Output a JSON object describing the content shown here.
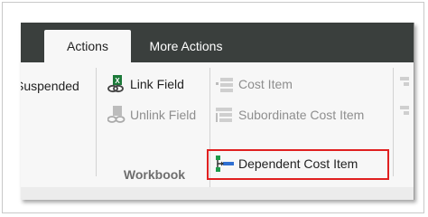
{
  "tabs": [
    {
      "label": "Actions",
      "active": true
    },
    {
      "label": "More Actions",
      "active": false
    }
  ],
  "partial_item": {
    "label": "Suspended"
  },
  "workbook_group": {
    "label": "Workbook",
    "link_field": {
      "label": "Link Field",
      "enabled": true
    },
    "unlink_field": {
      "label": "Unlink Field",
      "enabled": false
    }
  },
  "cost_group": {
    "cost_item": {
      "label": "Cost Item",
      "enabled": false
    },
    "subordinate_cost_item": {
      "label": "Subordinate Cost Item",
      "enabled": false
    },
    "dependent_cost_item": {
      "label": "Dependent Cost Item",
      "enabled": true,
      "highlighted": true
    }
  },
  "colors": {
    "tab_bar": "#3a3f3d",
    "ribbon_bg": "#f7f7f7",
    "highlight_border": "#e02020",
    "excel_green": "#1d7a3a",
    "dependent_icon_blue": "#2f6fd1"
  }
}
